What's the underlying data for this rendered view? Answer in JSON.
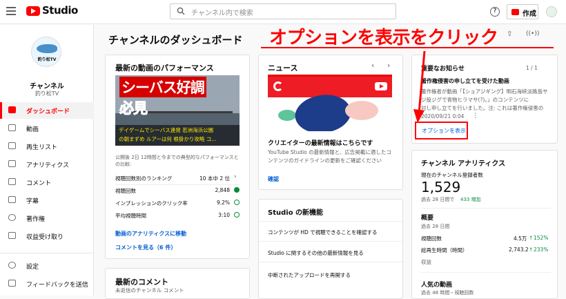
{
  "header": {
    "logo_text": "Studio",
    "search_placeholder": "チャンネル内で検索",
    "help_symbol": "?",
    "create_label": "作成"
  },
  "sidebar": {
    "channel_logo_text": "釣り松TV",
    "channel_title": "チャンネル",
    "channel_name": "釣り松TV",
    "items": [
      {
        "label": "ダッシュボード",
        "icon": "dashboard-icon",
        "active": true
      },
      {
        "label": "動画",
        "icon": "video-icon"
      },
      {
        "label": "再生リスト",
        "icon": "playlist-icon"
      },
      {
        "label": "アナリティクス",
        "icon": "analytics-icon"
      },
      {
        "label": "コメント",
        "icon": "comment-icon"
      },
      {
        "label": "字幕",
        "icon": "subtitles-icon"
      },
      {
        "label": "著作権",
        "icon": "copyright-icon"
      },
      {
        "label": "収益受け取り",
        "icon": "dollar-icon"
      }
    ],
    "bottom_items": [
      {
        "label": "設定",
        "icon": "gear-icon"
      },
      {
        "label": "フィードバックを送信",
        "icon": "feedback-icon"
      }
    ]
  },
  "main": {
    "page_title": "チャンネルのダッシュボード",
    "performance": {
      "title": "最新の動画のパフォーマンス",
      "thumb_text_1": "シーバス好調",
      "thumb_text_2": "必見",
      "thumb_caption_1": "デイゲームでシーバス連発 若洲海浜公園",
      "thumb_caption_2": "の朝まずめ ルアーは何 根掛かり攻略 コ...",
      "note": "公開後 2日 12時間と今までの典型的なパフォーマンスとの比較:",
      "rows": [
        {
          "label": "視聴回数別のランキング",
          "value": "10 本中 2 位",
          "status": "chevron"
        },
        {
          "label": "視聴回数",
          "value": "2,848",
          "status": "up"
        },
        {
          "label": "インプレッションのクリック率",
          "value": "9.2%",
          "status": "ok"
        },
        {
          "label": "平均視聴時間",
          "value": "3:10",
          "status": "ok"
        }
      ],
      "link_analytics": "動画のアナリティクスに移動",
      "link_comments": "コメントを見る（6 件）"
    },
    "latest_comments_title": "最新のコメント",
    "latest_comments_sub": "未返信のチャンネル コメント",
    "news": {
      "title": "ニュース",
      "prev": "‹",
      "next": "›",
      "headline": "クリエイターの最新情報はこちらです",
      "body": "YouTube Studio の最新情報と、広告掲載に適したコンテンツのガイドラインの更新をご確認ください",
      "link": "確認"
    },
    "studio_features": {
      "title": "Studio の新機能",
      "items": [
        "コンテンツが HD で視聴できることを確認する",
        "Studio に関するその他の最新情報を見る",
        "中断されたアップロードを再開する"
      ]
    },
    "alerts": {
      "title": "重要なお知らせ",
      "pager": "1 / 1",
      "headline": "著作権侵害の申し立てを受けた動画",
      "line1": "著作権者が動画「【ショアジギング】明石海峡淡路島サ",
      "line2": "ジ投ジグで青物ヒラマサ(?)。」のコンテンツに",
      "line3": "対し申し立てを行いました。注: これは著作権侵害の",
      "date": "2020/09/21 0:04",
      "options_label": "オプションを表示"
    },
    "analytics": {
      "title": "チャンネル アナリティクス",
      "subs_label": "現在のチャンネル登録者数",
      "subs_value": "1,529",
      "subs_change_prefix": "過去 28 日間で",
      "subs_change": "433 増加",
      "summary_title": "概要",
      "summary_period": "過去 28 日間",
      "views_label": "視聴回数",
      "views_value": "4.5万",
      "views_change": "152%",
      "watch_label": "総再生時間（時間）",
      "watch_value": "2,743.2",
      "watch_change": "233%",
      "revenue_label": "収益",
      "popular_title": "人気の動画",
      "popular_sub": "過去 48 時間・視聴回数"
    }
  },
  "annotation": {
    "text": "オプションを表示をクリック",
    "color": "#ff0000"
  }
}
